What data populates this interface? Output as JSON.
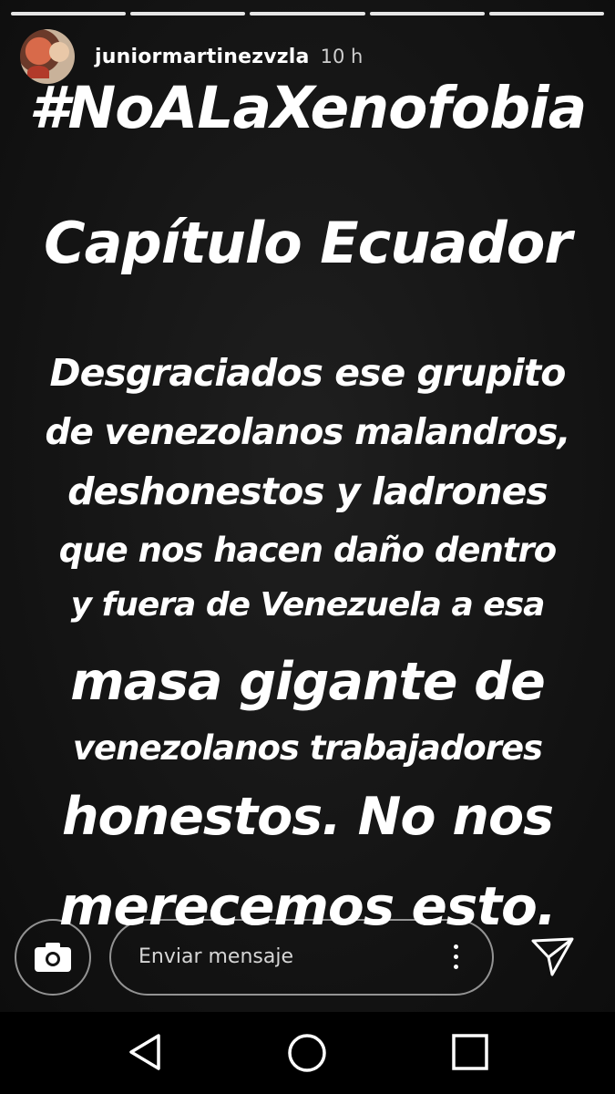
{
  "story": {
    "segments_total": 5,
    "segments_viewed": 5,
    "user": {
      "username": "juniormartinezvzla",
      "time_ago": "10 h"
    },
    "lines": [
      "#NoALaXenofobia",
      "Capítulo Ecuador",
      "Desgraciados ese grupito",
      "de venezolanos malandros,",
      "deshonestos y ladrones",
      "que nos hacen daño dentro",
      "y fuera de Venezuela a esa",
      "masa gigante de",
      "venezolanos trabajadores",
      "honestos. No nos",
      "merecemos esto."
    ]
  },
  "reply": {
    "placeholder": "Enviar mensaje",
    "camera_icon": "camera-icon",
    "options_icon": "more-vert-icon",
    "send_icon": "send-icon"
  },
  "navigation": {
    "back_icon": "back-triangle-icon",
    "home_icon": "home-circle-icon",
    "recents_icon": "recents-square-icon"
  },
  "colors": {
    "background": "#141414",
    "text": "#ffffff",
    "navbar": "#000000"
  }
}
